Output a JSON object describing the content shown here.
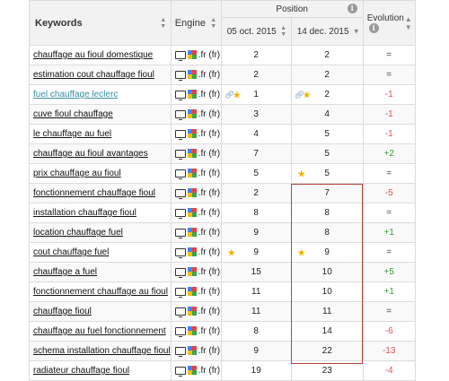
{
  "header": {
    "keywords_label": "Keywords",
    "engine_label": "Engine",
    "position_label": "Position",
    "date1": "05 oct. 2015",
    "date2": "14 dec. 2015",
    "evolution_label": "Evolution"
  },
  "icons": {
    "sort": "sort-arrows-icon",
    "info": "info-icon",
    "monitor": "desktop-monitor-icon",
    "google": "google-logo-icon",
    "star": "star-icon",
    "link": "link-icon",
    "caret": "chevron-down-icon"
  },
  "colors": {
    "negative": "#d9534f",
    "positive": "#3c9a3c",
    "highlight": "#b5443a",
    "teal_link": "#3a8fa0"
  },
  "rows": [
    {
      "keyword": "chauffage au fioul domestique",
      "engine": ".fr (fr)",
      "pos1": "2",
      "pos2": "2",
      "evolution": "=",
      "evo_type": "eq"
    },
    {
      "keyword": "estimation cout chauffage fioul",
      "engine": ".fr (fr)",
      "pos1": "2",
      "pos2": "2",
      "evolution": "=",
      "evo_type": "eq"
    },
    {
      "keyword": "fuel chauffage leclerc",
      "engine": ".fr (fr)",
      "pos1": "1",
      "pos2": "2",
      "evolution": "-1",
      "evo_type": "neg",
      "teal": true,
      "pos1_badge": "link-star",
      "pos2_badge": "link-star"
    },
    {
      "keyword": "cuve fioul chauffage",
      "engine": ".fr (fr)",
      "pos1": "3",
      "pos2": "4",
      "evolution": "-1",
      "evo_type": "neg"
    },
    {
      "keyword": "le chauffage au fuel",
      "engine": ".fr (fr)",
      "pos1": "4",
      "pos2": "5",
      "evolution": "-1",
      "evo_type": "neg"
    },
    {
      "keyword": "chauffage au fioul avantages",
      "engine": ".fr (fr)",
      "pos1": "7",
      "pos2": "5",
      "evolution": "+2",
      "evo_type": "pos"
    },
    {
      "keyword": "prix chauffage au fioul",
      "engine": ".fr (fr)",
      "pos1": "5",
      "pos2": "5",
      "evolution": "=",
      "evo_type": "eq",
      "pos2_badge": "star"
    },
    {
      "keyword": "fonctionnement chauffage fioul",
      "engine": ".fr (fr)",
      "pos1": "2",
      "pos2": "7",
      "evolution": "-5",
      "evo_type": "neg"
    },
    {
      "keyword": "installation chauffage fioul",
      "engine": ".fr (fr)",
      "pos1": "8",
      "pos2": "8",
      "evolution": "=",
      "evo_type": "eq"
    },
    {
      "keyword": "location chauffage fuel",
      "engine": ".fr (fr)",
      "pos1": "9",
      "pos2": "8",
      "evolution": "+1",
      "evo_type": "pos"
    },
    {
      "keyword": "cout chauffage fuel",
      "engine": ".fr (fr)",
      "pos1": "9",
      "pos2": "9",
      "evolution": "=",
      "evo_type": "eq",
      "pos1_badge": "star",
      "pos2_badge": "star"
    },
    {
      "keyword": "chauffage a fuel",
      "engine": ".fr (fr)",
      "pos1": "15",
      "pos2": "10",
      "evolution": "+5",
      "evo_type": "pos"
    },
    {
      "keyword": "fonctionnement chauffage au fioul",
      "engine": ".fr (fr)",
      "pos1": "11",
      "pos2": "10",
      "evolution": "+1",
      "evo_type": "pos"
    },
    {
      "keyword": "chauffage fioul",
      "engine": ".fr (fr)",
      "pos1": "11",
      "pos2": "11",
      "evolution": "=",
      "evo_type": "eq"
    },
    {
      "keyword": "chauffage au fuel fonctionnement",
      "engine": ".fr (fr)",
      "pos1": "8",
      "pos2": "14",
      "evolution": "-6",
      "evo_type": "neg"
    },
    {
      "keyword": "schema installation chauffage fioul",
      "engine": ".fr (fr)",
      "pos1": "9",
      "pos2": "22",
      "evolution": "-13",
      "evo_type": "neg"
    },
    {
      "keyword": "radiateur chauffage fioul",
      "engine": ".fr (fr)",
      "pos1": "19",
      "pos2": "23",
      "evolution": "-4",
      "evo_type": "neg"
    }
  ]
}
